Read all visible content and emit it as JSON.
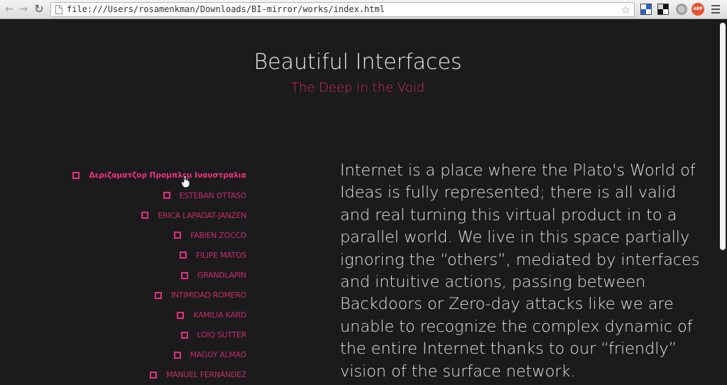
{
  "browser": {
    "url": "file:///Users/rosamenkman/Downloads/BI-mirror/works/index.html",
    "icons": [
      "back-arrow-icon",
      "forward-arrow-icon",
      "reload-icon",
      "page-icon",
      "star-icon",
      "menu-icon"
    ],
    "extension_badge": "ABP"
  },
  "site": {
    "title": "Beautiful Interfaces",
    "subtitle": "The Deep in the Void"
  },
  "artists": [
    "Δεριζαματζορ Προμπλεμ Ιναυστραλια",
    "ESTEBAN OTTASO",
    "ERICA LAPADAT-JANZEN",
    "FABIEN ZOCCO",
    "FILIPE MATOS",
    "GRANDLAPIN",
    "INTIMIDAD ROMERO",
    "KAMILIA KARD",
    "LOIQ SUTTER",
    "MAGGY ALMAO",
    "MANUEL FERNÁNDEZ"
  ],
  "active_artist_index": 0,
  "body_text": "Internet is a place where the Plato's World of Ideas is fully represented; there is all valid and real turning this virtual product in to a parallel world. We live in this space partially ignoring the “others”, mediated by interfaces and intuitive actions, passing between Backdoors or Zero-day attacks like we are unable to recognize the complex dynamic of the entire Internet thanks to our “friendly” vision of the surface network.",
  "colors": {
    "background": "#1b1b1c",
    "accent": "#d2276e",
    "text": "#e2e2e2"
  }
}
